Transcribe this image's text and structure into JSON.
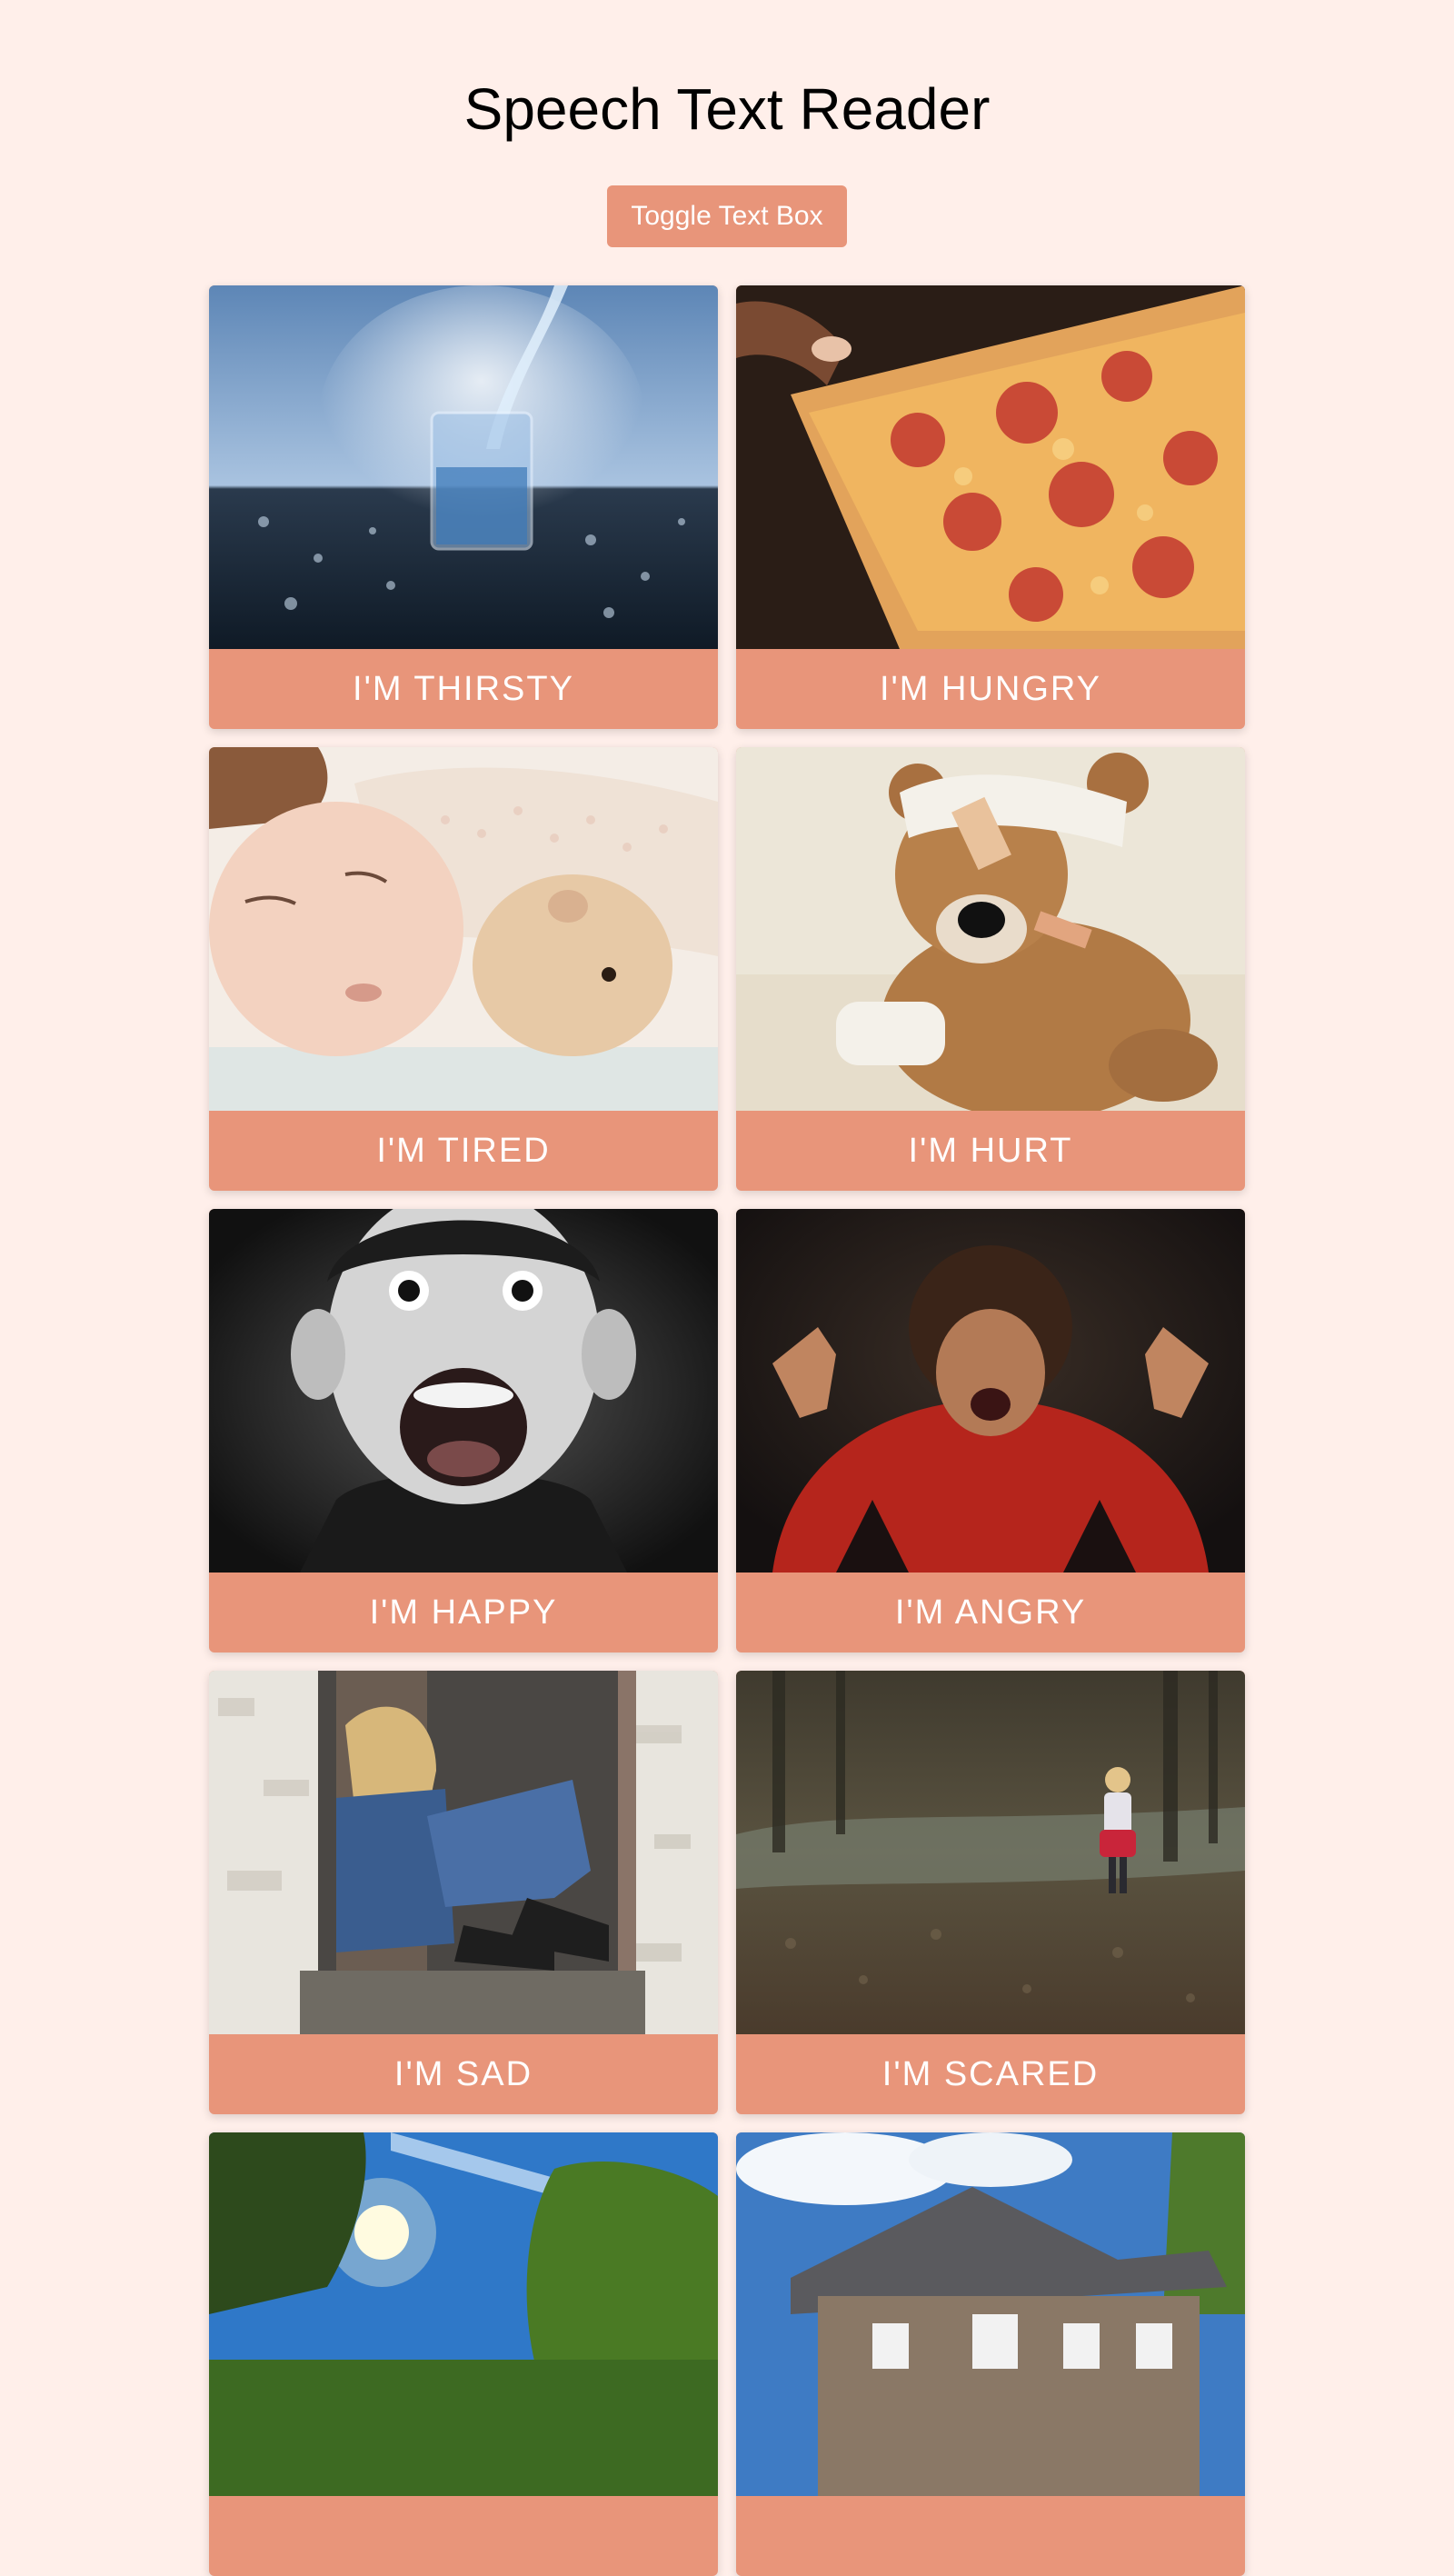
{
  "header": {
    "title": "Speech Text Reader"
  },
  "toolbar": {
    "toggle_label": "Toggle Text Box"
  },
  "cards": [
    {
      "label": "I'M THIRSTY",
      "image": "glass-of-water-image"
    },
    {
      "label": "I'M HUNGRY",
      "image": "pizza-slice-image"
    },
    {
      "label": "I'M TIRED",
      "image": "sleeping-child-image"
    },
    {
      "label": "I'M HURT",
      "image": "bandaged-teddy-bear-image"
    },
    {
      "label": "I'M HAPPY",
      "image": "excited-boy-image"
    },
    {
      "label": "I'M ANGRY",
      "image": "angry-child-image"
    },
    {
      "label": "I'M SAD",
      "image": "sad-child-in-doorway-image"
    },
    {
      "label": "I'M SCARED",
      "image": "child-in-forest-image"
    },
    {
      "label": "",
      "image": "sunny-park-trees-image"
    },
    {
      "label": "",
      "image": "house-image"
    }
  ],
  "colors": {
    "background": "#ffefea",
    "accent": "#e8957a",
    "label_text": "#ffffff"
  }
}
